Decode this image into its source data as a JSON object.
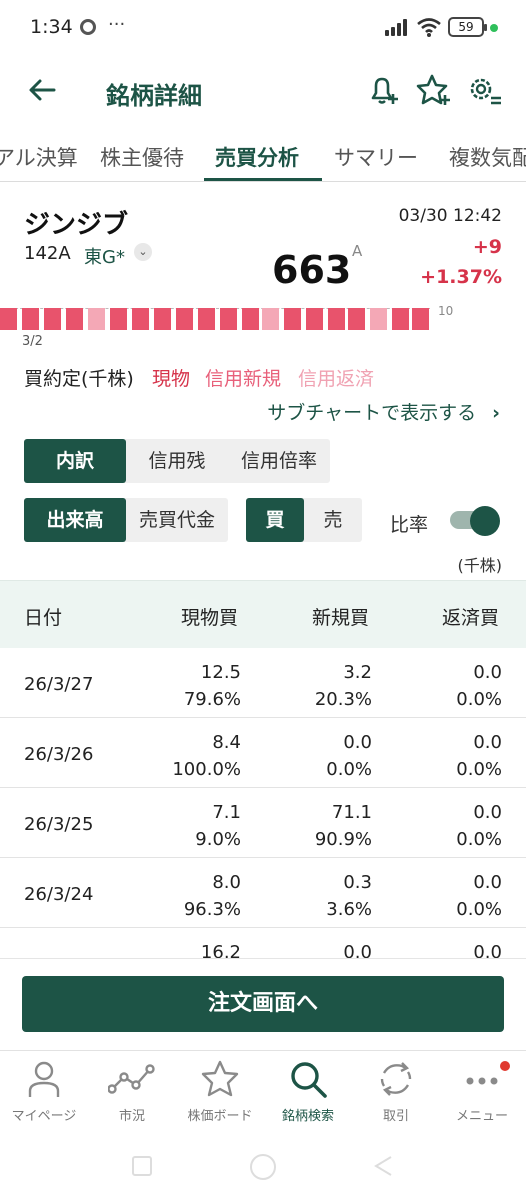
{
  "status_bar": {
    "time": "1:34",
    "dots": "···",
    "battery": "59"
  },
  "header": {
    "title": "銘柄詳細"
  },
  "tabs": [
    {
      "label": "アル決算"
    },
    {
      "label": "株主優待"
    },
    {
      "label": "売買分析",
      "active": true
    },
    {
      "label": "サマリー"
    },
    {
      "label": "複数気配"
    }
  ],
  "stock": {
    "name": "ジンジブ",
    "code": "142A",
    "market": "東G*",
    "market_chevron": "⌄",
    "price": "663",
    "price_flag": "A",
    "datetime": "03/30 12:42",
    "change": "+9",
    "change_pct": "+1.37%"
  },
  "chart": {
    "axis_value": "10",
    "start_date": "3/2"
  },
  "legend": {
    "label": "買約定(千株)",
    "items": [
      "現物",
      "信用新規",
      "信用返済"
    ],
    "colors": [
      "#d6334a",
      "#e8607a",
      "#f0a2b2"
    ]
  },
  "subchart_link": "サブチャートで表示する",
  "chevron": "›",
  "segment1": [
    "内訳",
    "信用残",
    "信用倍率"
  ],
  "segment2": [
    "出来高",
    "売買代金"
  ],
  "segment3": [
    "買",
    "売"
  ],
  "ratio_toggle": {
    "label": "比率",
    "on": true
  },
  "unit": "(千株)",
  "table": {
    "headers": [
      "日付",
      "現物買",
      "新規買",
      "返済買"
    ],
    "rows": [
      {
        "date": "26/3/27",
        "c1": [
          "12.5",
          "79.6%"
        ],
        "c2": [
          "3.2",
          "20.3%"
        ],
        "c3": [
          "0.0",
          "0.0%"
        ]
      },
      {
        "date": "26/3/26",
        "c1": [
          "8.4",
          "100.0%"
        ],
        "c2": [
          "0.0",
          "0.0%"
        ],
        "c3": [
          "0.0",
          "0.0%"
        ]
      },
      {
        "date": "26/3/25",
        "c1": [
          "7.1",
          "9.0%"
        ],
        "c2": [
          "71.1",
          "90.9%"
        ],
        "c3": [
          "0.0",
          "0.0%"
        ]
      },
      {
        "date": "26/3/24",
        "c1": [
          "8.0",
          "96.3%"
        ],
        "c2": [
          "0.3",
          "3.6%"
        ],
        "c3": [
          "0.0",
          "0.0%"
        ]
      },
      {
        "date": "",
        "c1": [
          "16.2",
          ""
        ],
        "c2": [
          "0.0",
          ""
        ],
        "c3": [
          "0.0",
          ""
        ]
      }
    ]
  },
  "order_button": "注文画面へ",
  "bottom_nav": [
    {
      "label": "マイページ",
      "icon": "person-icon"
    },
    {
      "label": "市況",
      "icon": "market-line-icon"
    },
    {
      "label": "株価ボード",
      "icon": "star-icon"
    },
    {
      "label": "銘柄検索",
      "icon": "search-icon",
      "active": true
    },
    {
      "label": "取引",
      "icon": "refresh-icon"
    },
    {
      "label": "メニュー",
      "icon": "more-icon",
      "badge": true
    }
  ]
}
